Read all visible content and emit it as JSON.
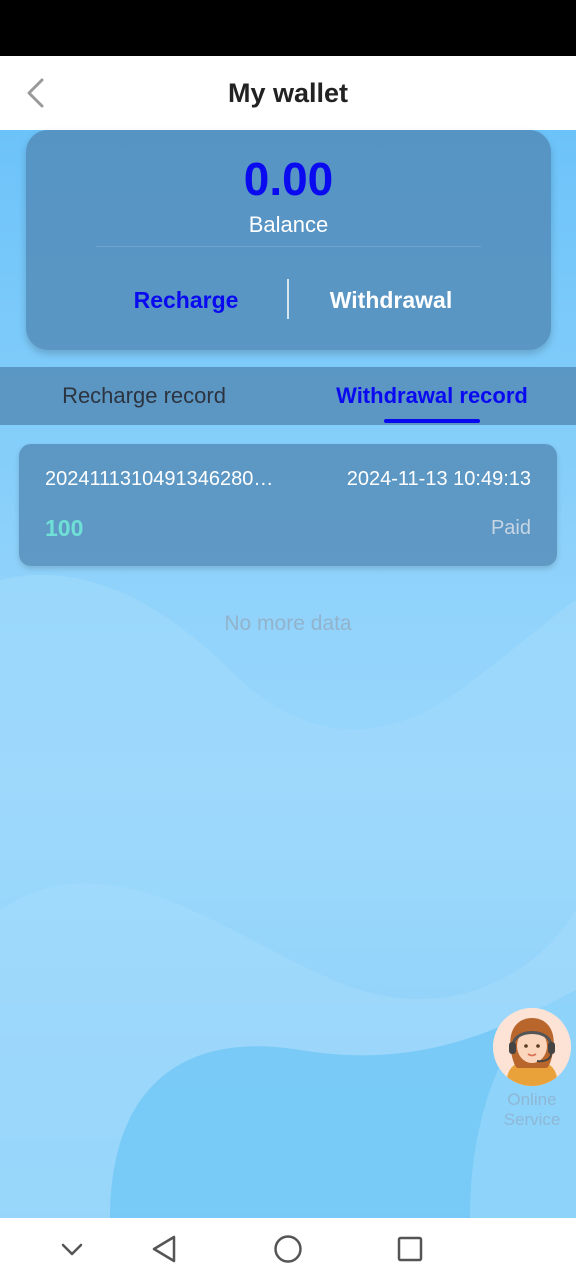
{
  "header": {
    "title": "My wallet",
    "back_icon": "chevron-left-icon"
  },
  "wallet": {
    "balance": "0.00",
    "balance_label": "Balance",
    "recharge_label": "Recharge",
    "withdrawal_label": "Withdrawal"
  },
  "tabs": [
    {
      "label": "Recharge record",
      "active": false
    },
    {
      "label": "Withdrawal record",
      "active": true
    }
  ],
  "records": [
    {
      "order_id": "2024111310491346280…",
      "time": "2024-11-13 10:49:13",
      "amount": "100",
      "status": "Paid"
    }
  ],
  "list_footer": "No more data",
  "service": {
    "label": "Online Service",
    "icon": "customer-service-avatar-icon"
  },
  "system_nav": [
    "chevron-down-icon",
    "back-triangle-icon",
    "home-circle-icon",
    "recents-square-icon"
  ],
  "colors": {
    "accent_blue": "#0a0af0",
    "amount_teal": "#6fe0d6",
    "background": "#6cc3f9",
    "card": "#4e82af"
  }
}
